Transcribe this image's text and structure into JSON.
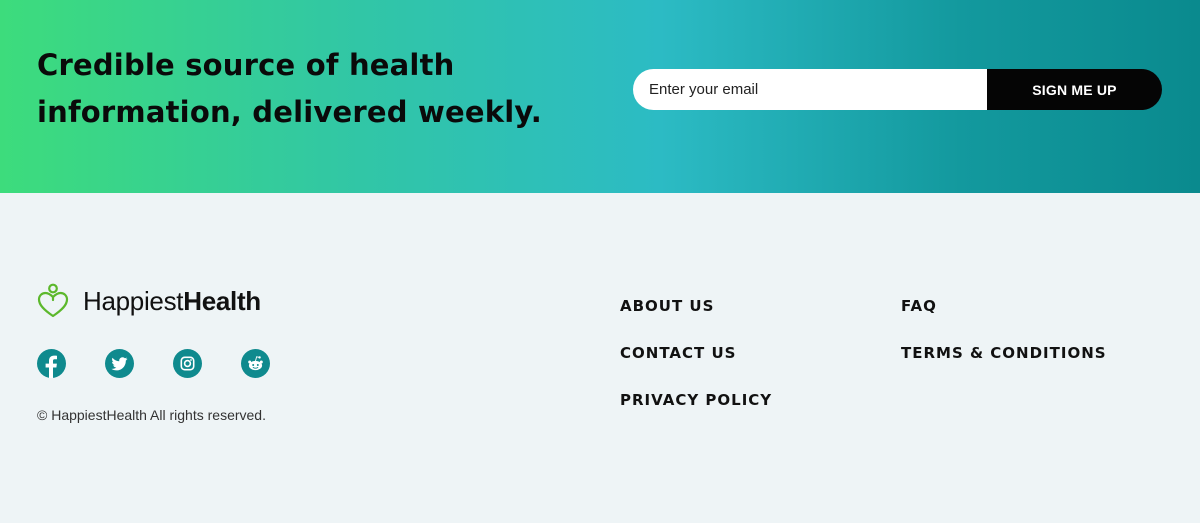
{
  "newsletter": {
    "tagline_line1": "Credible source of health",
    "tagline_line2": "information, delivered weekly.",
    "email_placeholder": "Enter your email",
    "button_label": "SIGN ME UP"
  },
  "footer": {
    "logo": {
      "text_regular": "Happiest",
      "text_bold": "Health",
      "icon": "heart-person-icon"
    },
    "socials": [
      {
        "name": "facebook",
        "icon": "facebook-icon"
      },
      {
        "name": "twitter",
        "icon": "twitter-icon"
      },
      {
        "name": "instagram",
        "icon": "instagram-icon"
      },
      {
        "name": "reddit",
        "icon": "reddit-icon"
      }
    ],
    "copyright": "© HappiestHealth All rights reserved.",
    "links_col1": [
      "ABOUT US",
      "CONTACT US",
      "PRIVACY POLICY"
    ],
    "links_col2": [
      "FAQ",
      "TERMS & CONDITIONS"
    ]
  },
  "colors": {
    "gradient_start": "#3ddc7c",
    "gradient_mid": "#2cbbc4",
    "gradient_end": "#0a8a8e",
    "social_icon_bg": "#0f8a8e",
    "logo_green": "#5cb82c",
    "footer_bg": "#eef4f6",
    "button_bg": "#050505"
  }
}
